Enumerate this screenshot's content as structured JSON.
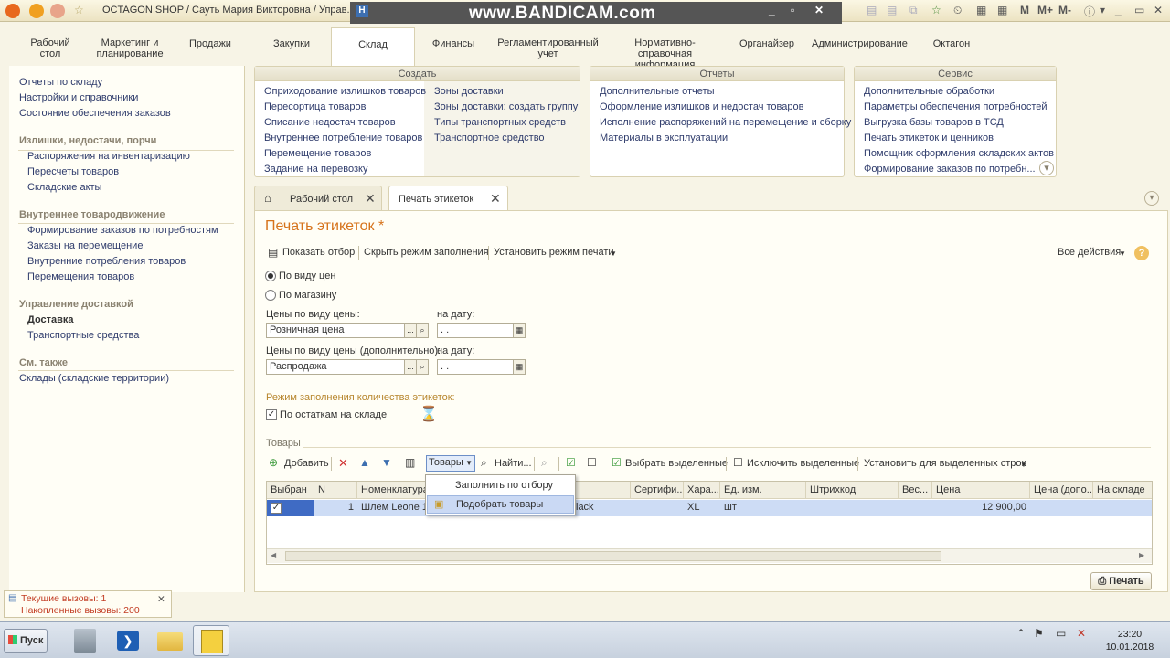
{
  "window": {
    "title": "OCTAGON SHOP / Сауть Мария Викторовна / Управ...",
    "watermark": "www.BANDICAM.com",
    "right_buttons": [
      "M",
      "M+",
      "M-"
    ]
  },
  "sections": [
    {
      "label": "Рабочий стол"
    },
    {
      "label": "Маркетинг и планирование"
    },
    {
      "label": "Продажи"
    },
    {
      "label": "Закупки"
    },
    {
      "label": "Склад"
    },
    {
      "label": "Финансы"
    },
    {
      "label": "Регламентированный учет"
    },
    {
      "label": "Нормативно-справочная информация"
    },
    {
      "label": "Органайзер"
    },
    {
      "label": "Администрирование"
    },
    {
      "label": "Октагон"
    }
  ],
  "left_panel": {
    "items_top": [
      "Отчеты по складу",
      "Настройки и справочники",
      "Состояние обеспечения заказов"
    ],
    "group1": "Излишки, недостачи, порчи",
    "group1_items": [
      "Распоряжения на инвентаризацию",
      "Пересчеты товаров",
      "Складские акты"
    ],
    "group2": "Внутреннее товародвижение",
    "group2_items": [
      "Формирование заказов по потребностям",
      "Заказы на перемещение",
      "Внутренние потребления товаров",
      "Перемещения товаров"
    ],
    "group3": "Управление доставкой",
    "group3_items": [
      "Доставка",
      "Транспортные средства"
    ],
    "group4": "См. также",
    "group4_items": [
      "Склады (складские территории)"
    ]
  },
  "action_panels": {
    "create": {
      "title": "Создать",
      "col1": [
        "Оприходование излишков товаров",
        "Пересортица товаров",
        "Списание недостач товаров",
        "Внутреннее потребление товаров",
        "Перемещение товаров",
        "Задание на перевозку"
      ],
      "col2": [
        "Зоны доставки",
        "Зоны доставки: создать группу",
        "Типы транспортных средств",
        "Транспортное средство"
      ]
    },
    "reports": {
      "title": "Отчеты",
      "items": [
        "Дополнительные отчеты",
        "Оформление излишков и недостач товаров",
        "Исполнение распоряжений на перемещение и сборку",
        "Материалы в эксплуатации"
      ]
    },
    "service": {
      "title": "Сервис",
      "items": [
        "Дополнительные обработки",
        "Параметры обеспечения потребностей",
        "Выгрузка базы товаров в ТСД",
        "Печать этикеток и ценников",
        "Помощник оформления складских актов",
        "Формирование заказов по потребн..."
      ]
    }
  },
  "tabs": [
    {
      "label": "Рабочий стол"
    },
    {
      "label": "Печать этикеток"
    }
  ],
  "form": {
    "title": "Печать этикеток *",
    "commands": {
      "show_filter": "Показать отбор",
      "hide_fill": "Скрыть режим заполнения",
      "print_mode": "Установить режим печати",
      "all_actions": "Все действия"
    },
    "radio_by_price": "По виду цен",
    "radio_by_store": "По магазину",
    "price_type_label": "Цены по виду цены:",
    "price_type_value": "Розничная цена",
    "date_label": "на дату:",
    "date_value": " .  .",
    "price_type2_label": "Цены по виду цены (дополнительно):",
    "price_type2_value": "Распродажа",
    "date2_label": "на дату:",
    "date2_value": " .  .",
    "fill_mode_label": "Режим заполнения количества этикеток:",
    "by_stock_label": "По остаткам на складе",
    "goods_group": "Товары",
    "toolbar": {
      "add": "Добавить",
      "goods": "Товары",
      "find": "Найти...",
      "select_selected": "Выбрать выделенные",
      "exclude_selected": "Исключить выделенные",
      "set_for_selected": "Установить для выделенных строк"
    },
    "dropdown": [
      "Заполнить по отбору",
      "Подобрать товары"
    ],
    "table": {
      "columns": [
        "Выбран",
        "N",
        "Номенклатура",
        "Сертифи...",
        "Хара...",
        "Ед. изм.",
        "Штрихкод",
        "Вес...",
        "Цена",
        "Цена (допо...",
        "На складе"
      ],
      "row": {
        "n": "1",
        "name": "Шлем Leone 15",
        "name_tail": "lack",
        "characteristic": "XL",
        "unit": "шт",
        "price": "12 900,00"
      }
    },
    "print_button": "Печать"
  },
  "notification": {
    "current": "Текущие вызовы: 1",
    "accumulated": "Накопленные вызовы: 200"
  },
  "taskbar": {
    "start": "Пуск",
    "time": "23:20",
    "date": "10.01.2018"
  }
}
